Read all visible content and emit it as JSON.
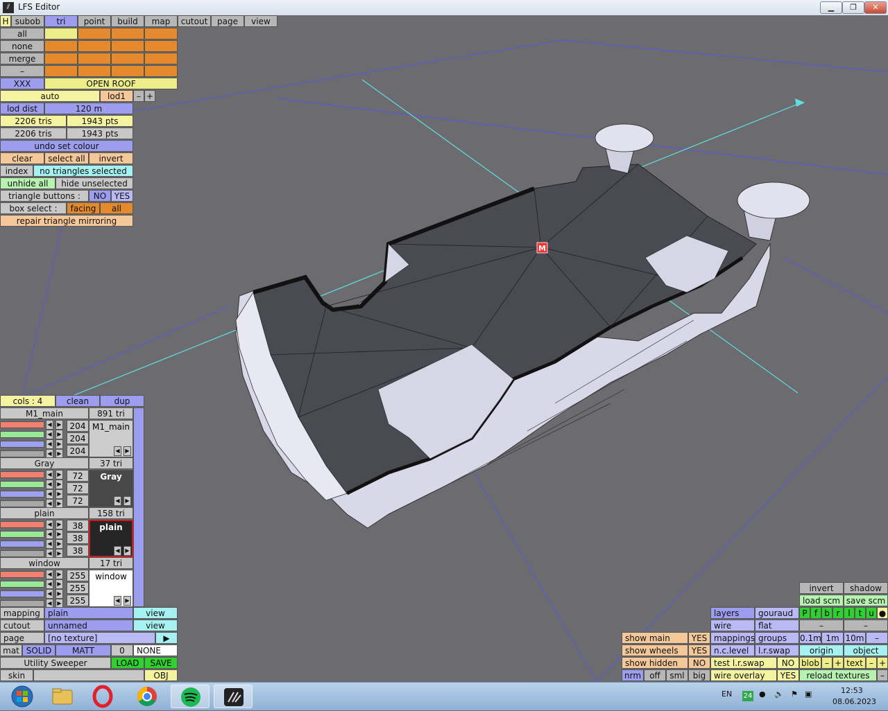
{
  "window": {
    "title": "LFS Editor",
    "icon": "lfs-logo-icon"
  },
  "tabs": [
    "H",
    "subob",
    "tri",
    "point",
    "build",
    "map",
    "cutout",
    "page",
    "view"
  ],
  "selection_rows": [
    "all",
    "none",
    "merge",
    "–"
  ],
  "xxx_label": "XXX",
  "object_name": "OPEN ROOF",
  "lod": {
    "auto": "auto",
    "lod": "lod1",
    "minus": "–",
    "plus": "+"
  },
  "lod_dist": {
    "label": "lod dist",
    "value": "120 m"
  },
  "counts": [
    {
      "tris": "2206 tris",
      "pts": "1943 pts"
    },
    {
      "tris": "2206 tris",
      "pts": "1943 pts"
    }
  ],
  "undo": "undo set colour",
  "sel_buttons": {
    "clear": "clear",
    "select_all": "select all",
    "invert": "invert"
  },
  "index": {
    "label": "index",
    "value": "no triangles selected"
  },
  "hide": {
    "unhide": "unhide all",
    "hide_unselected": "hide unselected"
  },
  "tri_buttons": {
    "label": "triangle buttons :",
    "no": "NO",
    "yes": "YES"
  },
  "box_select": {
    "label": "box select :",
    "facing": "facing",
    "all": "all"
  },
  "repair": "repair triangle mirroring",
  "colors_header": {
    "cols": "cols : 4",
    "clean": "clean",
    "dup": "dup"
  },
  "materials": [
    {
      "name": "M1_main",
      "tri": "891 tri",
      "r": "204",
      "g": "204",
      "b": "204",
      "preview": "M1_main",
      "preview_color": "#cccccc",
      "text_color": "#000000"
    },
    {
      "name": "Gray",
      "tri": "37 tri",
      "r": "72",
      "g": "72",
      "b": "72",
      "preview": "Gray",
      "preview_color": "#484848",
      "text_color": "#ffffff"
    },
    {
      "name": "plain",
      "tri": "158 tri",
      "r": "38",
      "g": "38",
      "b": "38",
      "preview": "plain",
      "preview_color": "#262626",
      "text_color": "#ffffff"
    },
    {
      "name": "window",
      "tri": "17 tri",
      "r": "255",
      "g": "255",
      "b": "255",
      "preview": "window",
      "preview_color": "#ffffff",
      "text_color": "#000000"
    }
  ],
  "mapping": {
    "label": "mapping",
    "value": "plain",
    "view": "view"
  },
  "cutout": {
    "label": "cutout",
    "value": "unnamed",
    "view": "view"
  },
  "page": {
    "label": "page",
    "value": "[no texture]",
    "arrow": "▶"
  },
  "mat": {
    "label": "mat",
    "solid": "SOLID",
    "matt": "MATT",
    "zero": "0",
    "none": "NONE"
  },
  "utility": {
    "label": "Utility Sweeper",
    "load": "LOAD",
    "save": "SAVE"
  },
  "skin": {
    "label": "skin",
    "obj": "OBJ"
  },
  "viewport": {
    "marker": "M"
  },
  "view_panel": {
    "invert": "invert",
    "shadow": "shadow",
    "load_scm": "load scm",
    "save_scm": "save scm",
    "flags": [
      "P",
      "f",
      "b",
      "r",
      "l",
      "t",
      "u",
      "●"
    ],
    "dash1": "–",
    "dash2": "–",
    "layers": "layers",
    "gouraud": "gouraud",
    "wire": "wire",
    "flat": "flat",
    "show_main": "show main",
    "show_main_v": "YES",
    "mappings": "mappings",
    "groups": "groups",
    "s01": "0.1m",
    "s1": "1m",
    "s10": "10m",
    "sdash": "–",
    "show_wheels": "show wheels",
    "show_wheels_v": "YES",
    "nc_level": "n.c.level",
    "lr_swap": "l.r.swap",
    "origin": "origin",
    "object": "object",
    "show_hidden": "show hidden",
    "show_hidden_v": "NO",
    "test_lr": "test l.r.swap",
    "test_lr_v": "NO",
    "blob": "blob",
    "bm": "–",
    "bp": "+",
    "text": "text",
    "tm": "–",
    "tp": "+",
    "nrm": "nrm",
    "off": "off",
    "sml": "sml",
    "big": "big",
    "wire_overlay": "wire overlay",
    "wire_overlay_v": "YES",
    "reload": "reload textures",
    "rdash": "–"
  },
  "taskbar": {
    "apps": [
      "windows-start-icon",
      "file-explorer-icon",
      "opera-icon",
      "chrome-icon",
      "spotify-icon",
      "lfs-icon"
    ],
    "lang": "EN",
    "badge": "24",
    "time": "12:53",
    "date": "08.06.2023"
  }
}
